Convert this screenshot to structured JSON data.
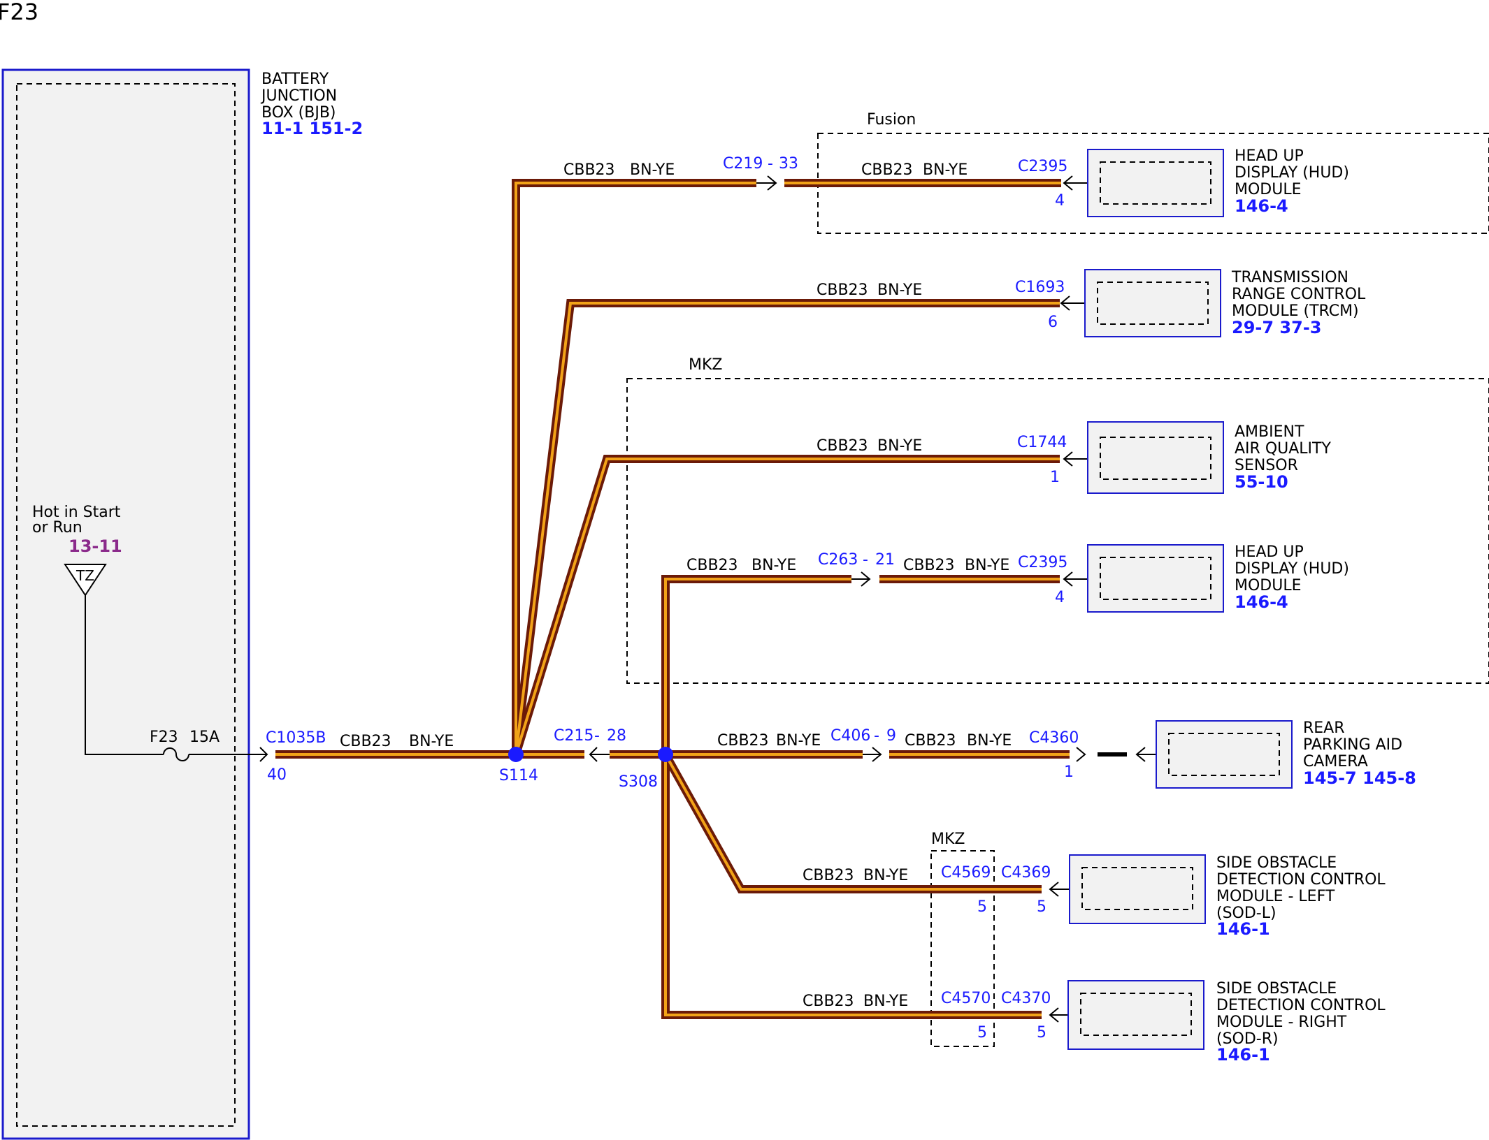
{
  "title": "F23",
  "colors": {
    "wire_outer": "#6b1a08",
    "wire_inner": "#f2a318",
    "connector": "#1a1aff",
    "reference": "#1a1aff",
    "feed_reference": "#8b2a8b",
    "module_border": "#1a1acc",
    "module_fill": "#f2f2f2"
  },
  "bjb": {
    "lines": [
      "BATTERY",
      "JUNCTION",
      "BOX (BJB)"
    ],
    "refs": "11-1   151-2"
  },
  "power": {
    "lines": [
      "Hot in Start",
      "or Run"
    ],
    "ref": "13-11",
    "symbol": "TZ"
  },
  "fuse": {
    "name": "F23",
    "rating": "15A"
  },
  "wire": {
    "circuit": "CBB23",
    "color": "BN-YE"
  },
  "groups": {
    "fusion": "Fusion",
    "mkz": "MKZ"
  },
  "connectors": {
    "c1035b": "C1035B",
    "c1035b_pin": "40",
    "c219": "C219",
    "c219_pin": "33",
    "c2395": "C2395",
    "c2395_pin": "4",
    "c1693": "C1693",
    "c1693_pin": "6",
    "c1744": "C1744",
    "c1744_pin": "1",
    "c263": "C263",
    "c263_pin": "21",
    "c215": "C215",
    "c215_pin": "28",
    "c406": "C406",
    "c406_pin": "9",
    "c4360": "C4360",
    "c4360_pin": "1",
    "c4569": "C4569",
    "c4569_pin": "5",
    "c4369": "C4369",
    "c4369_pin": "5",
    "c4570": "C4570",
    "c4570_pin": "5",
    "c4370": "C4370",
    "c4370_pin": "5",
    "dash": "-"
  },
  "splices": {
    "s114": "S114",
    "s308": "S308"
  },
  "modules": {
    "hud1": {
      "lines": [
        "HEAD UP",
        "DISPLAY (HUD)",
        "MODULE"
      ],
      "ref": "146-4"
    },
    "trcm": {
      "lines": [
        "TRANSMISSION",
        "RANGE CONTROL",
        "MODULE (TRCM)"
      ],
      "ref": "29-7   37-3"
    },
    "aaqs": {
      "lines": [
        "AMBIENT",
        "AIR QUALITY",
        "SENSOR"
      ],
      "ref": "55-10"
    },
    "hud2": {
      "lines": [
        "HEAD UP",
        "DISPLAY (HUD)",
        "MODULE"
      ],
      "ref": "146-4"
    },
    "rpac": {
      "lines": [
        "REAR",
        "PARKING AID",
        "CAMERA"
      ],
      "ref": "145-7 145-8"
    },
    "sodl": {
      "lines": [
        "SIDE OBSTACLE",
        "DETECTION CONTROL",
        "MODULE - LEFT",
        "(SOD-L)"
      ],
      "ref": "146-1"
    },
    "sodr": {
      "lines": [
        "SIDE OBSTACLE",
        "DETECTION CONTROL",
        "MODULE - RIGHT",
        "(SOD-R)"
      ],
      "ref": "146-1"
    }
  }
}
